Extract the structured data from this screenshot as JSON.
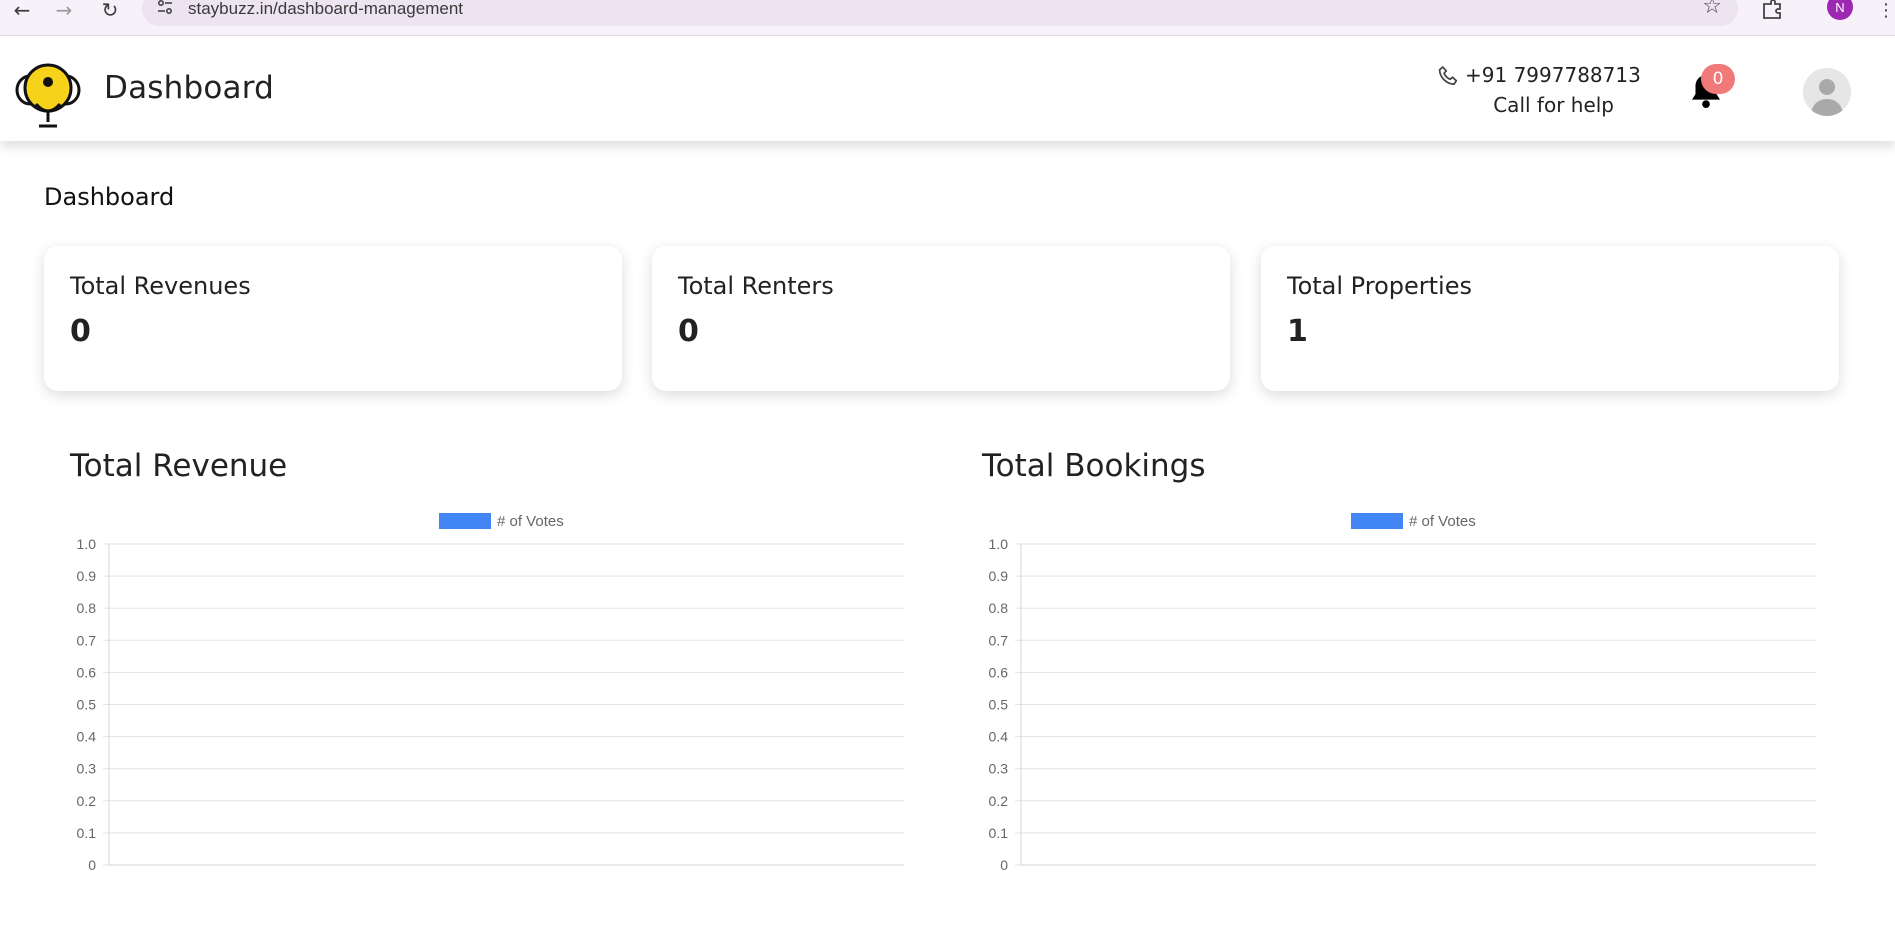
{
  "browser": {
    "url": "staybuzz.in/dashboard-management",
    "profile_initial": "N"
  },
  "header": {
    "title": "Dashboard",
    "phone": "+91 7997788713",
    "help_text": "Call for help",
    "notification_count": "0"
  },
  "page": {
    "title": "Dashboard",
    "stats": [
      {
        "label": "Total Revenues",
        "value": "0"
      },
      {
        "label": "Total Renters",
        "value": "0"
      },
      {
        "label": "Total Properties",
        "value": "1"
      }
    ]
  },
  "colors": {
    "brand_yellow": "#f7d21b",
    "bar_blue": "#4285f4",
    "badge": "#f27979"
  },
  "chart_data": [
    {
      "type": "bar",
      "title": "Total Revenue",
      "series": [
        {
          "name": "# of Votes",
          "values": []
        }
      ],
      "categories": [],
      "ylim": [
        0,
        1.0
      ],
      "yticks": [
        "1.0",
        "0.9",
        "0.8",
        "0.7",
        "0.6",
        "0.5",
        "0.4",
        "0.3",
        "0.2",
        "0.1",
        "0"
      ],
      "grid": true,
      "legend": "top-center"
    },
    {
      "type": "bar",
      "title": "Total Bookings",
      "series": [
        {
          "name": "# of Votes",
          "values": []
        }
      ],
      "categories": [],
      "ylim": [
        0,
        1.0
      ],
      "yticks": [
        "1.0",
        "0.9",
        "0.8",
        "0.7",
        "0.6",
        "0.5",
        "0.4",
        "0.3",
        "0.2",
        "0.1",
        "0"
      ],
      "grid": true,
      "legend": "top-center"
    }
  ]
}
